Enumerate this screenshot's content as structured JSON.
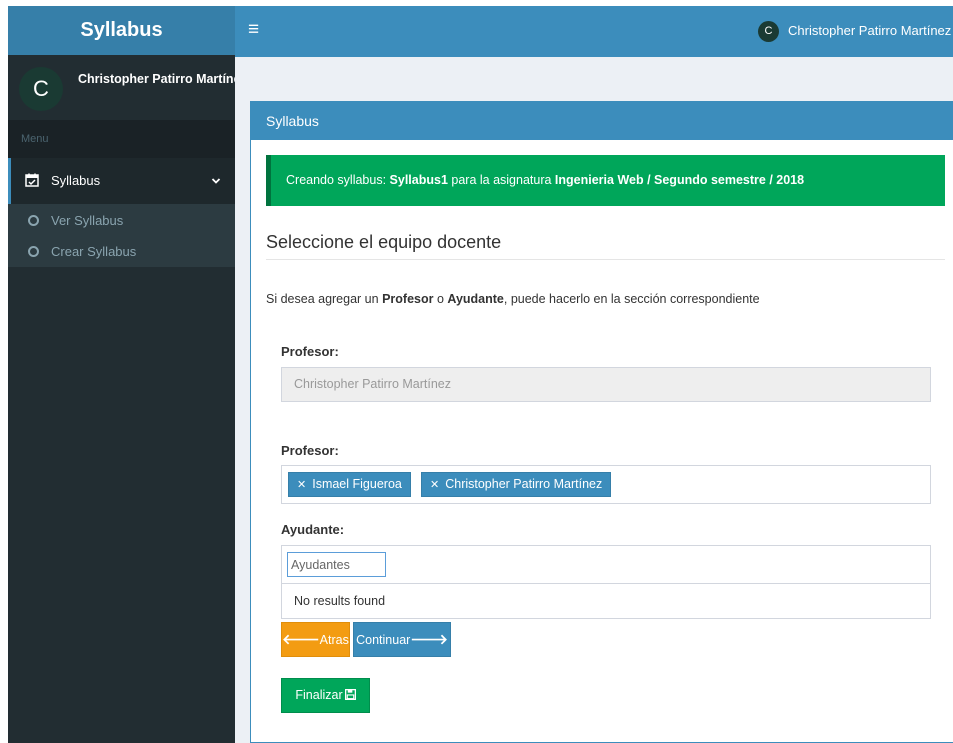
{
  "sidebar": {
    "brand": "Syllabus",
    "user_avatar_letter": "C",
    "user_name": "Christopher Patirro Martínez",
    "menu_header": "Menu",
    "menu_item": {
      "label": "Syllabus",
      "icon": "calendar-check-icon"
    },
    "submenu": [
      {
        "label": "Ver Syllabus"
      },
      {
        "label": "Crear Syllabus"
      }
    ]
  },
  "header": {
    "menu_icon": "≡",
    "user_avatar_letter": "C",
    "user_name": "Christopher Patirro Martínez"
  },
  "box": {
    "title": "Syllabus",
    "alert": {
      "prefix": "Creando syllabus: ",
      "syllabus": "Syllabus1",
      "middle": " para la asignatura ",
      "subject": "Ingenieria Web / Segundo semestre / 2018"
    },
    "section_title": "Seleccione el equipo docente",
    "help": {
      "part1": "Si desea agregar un ",
      "profesor": "Profesor",
      "part2": " o ",
      "ayudante": "Ayudante",
      "part3": ", puede hacerlo en la sección correspondiente"
    },
    "profesor1_label": "Profesor:",
    "profesor1_value": "Christopher Patirro Martínez",
    "profesor2_label": "Profesor:",
    "profesor_tags": [
      {
        "label": "Ismael Figueroa"
      },
      {
        "label": "Christopher Patirro Martínez"
      }
    ],
    "ayudante_label": "Ayudante:",
    "ayudante_search_value": "Ayudantes",
    "ayudante_no_results": "No results found",
    "btn_atras": "Atras",
    "btn_continuar": "Continuar",
    "btn_finalizar": "Finalizar"
  },
  "colors": {
    "brand_blue": "#3c8dbc",
    "brand_dark_blue": "#367fa9",
    "sidebar_bg": "#222d32",
    "success": "#00a65a",
    "warning": "#f39c12"
  }
}
